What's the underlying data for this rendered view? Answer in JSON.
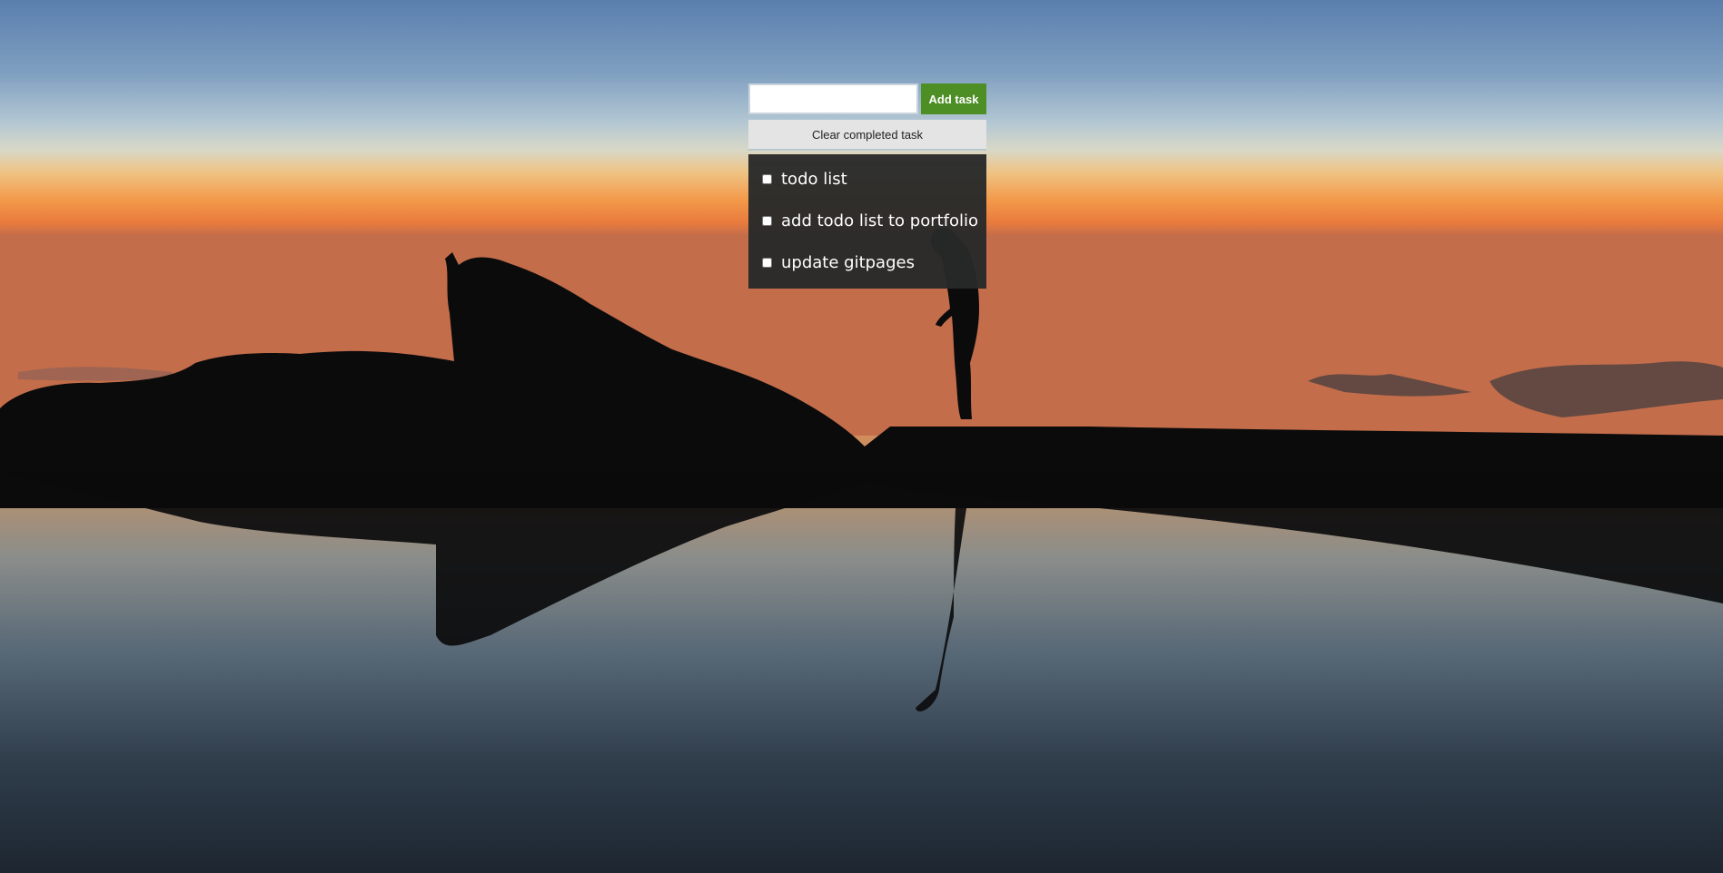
{
  "background": {
    "description_icon": "sunset-lake-silhouette-image",
    "colors": {
      "sky_top": "#5a7fae",
      "sky_mid": "#b3c7d3",
      "horizon": "#f39a4a",
      "silhouette": "#0b0b0c",
      "water_bottom": "#1d2630"
    }
  },
  "todo": {
    "input_value": "",
    "input_placeholder": "",
    "add_button_label": "Add task",
    "clear_button_label": "Clear completed task",
    "tasks": [
      {
        "label": "todo list",
        "checked": false
      },
      {
        "label": "add todo list to portfolio",
        "checked": false
      },
      {
        "label": "update gitpages",
        "checked": false
      }
    ],
    "accent_color": "#4e8f25"
  }
}
